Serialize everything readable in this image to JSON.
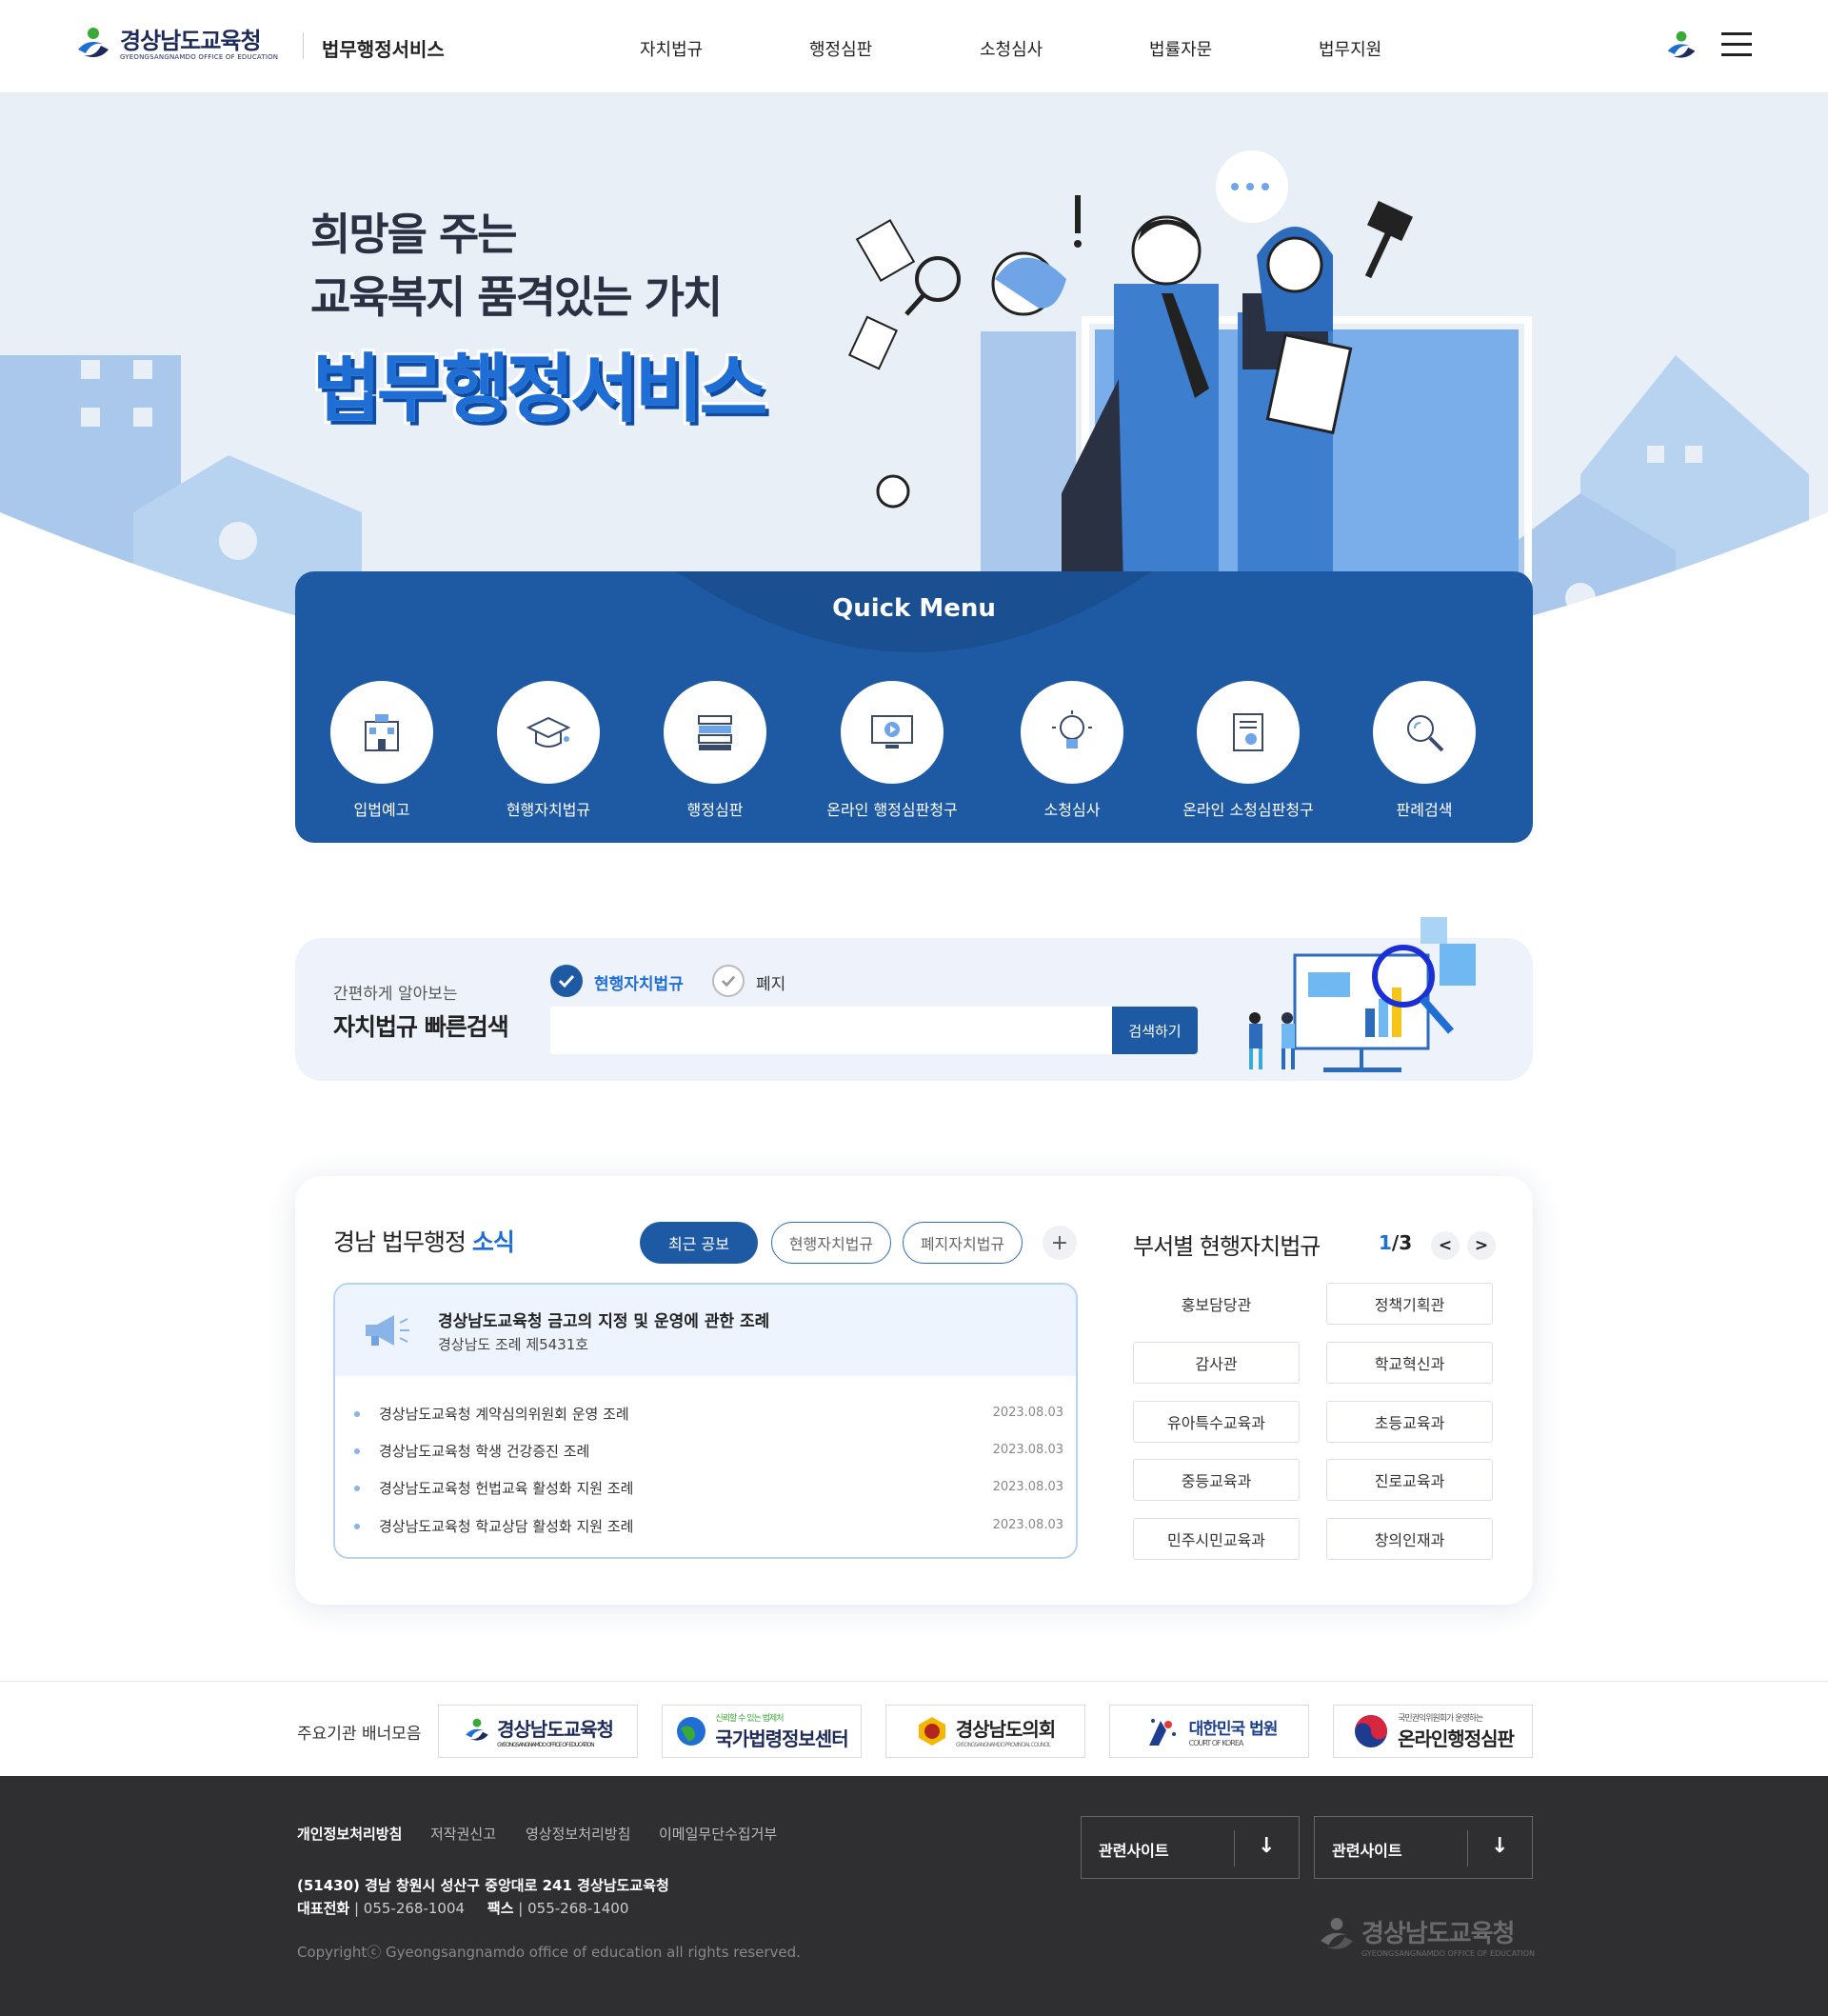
{
  "header": {
    "logo_main": "경상남도교육청",
    "logo_sub": "GYEONGSANGNAMDO OFFICE OF EDUCATION",
    "service_name": "법무행정서비스",
    "nav": [
      "자치법규",
      "행정심판",
      "소청심사",
      "법률자문",
      "법무지원"
    ]
  },
  "hero": {
    "line1": "희망을 주는",
    "line2": "교육복지 품격있는 가치",
    "big": "법무행정서비스"
  },
  "quick_menu": {
    "title": "Quick Menu",
    "items": [
      {
        "label": "입법예고",
        "icon": "building-icon"
      },
      {
        "label": "현행자치법규",
        "icon": "graduation-cap-icon"
      },
      {
        "label": "행정심판",
        "icon": "books-icon"
      },
      {
        "label": "온라인 행정심판청구",
        "icon": "monitor-play-icon"
      },
      {
        "label": "소청심사",
        "icon": "lightbulb-icon"
      },
      {
        "label": "온라인 소청심판청구",
        "icon": "certificate-icon"
      },
      {
        "label": "판례검색",
        "icon": "magnifier-icon"
      }
    ]
  },
  "search": {
    "subtitle": "간편하게 알아보는",
    "title": "자치법규 빠른검색",
    "option_current": "현행자치법규",
    "option_abolished": "폐지",
    "input_value": "",
    "button": "검색하기"
  },
  "news": {
    "title_plain": "경남 법무행정",
    "title_accent": "소식",
    "tabs": [
      "최근 공보",
      "현행자치법규",
      "폐지자치법규"
    ],
    "more": "+",
    "featured": {
      "title": "경상남도교육청 금고의 지정 및 운영에 관한 조례",
      "subtitle": "경상남도 조례 제5431호"
    },
    "items": [
      {
        "title": "경상남도교육청 계약심의위원회 운영 조례",
        "date": "2023.08.03"
      },
      {
        "title": "경상남도교육청 학생 건강증진 조례",
        "date": "2023.08.03"
      },
      {
        "title": "경상남도교육청 헌법교육 활성화 지원 조례",
        "date": "2023.08.03"
      },
      {
        "title": "경상남도교육청 학교상담 활성화 지원 조례",
        "date": "2023.08.03"
      }
    ]
  },
  "departments": {
    "title": "부서별 현행자치법규",
    "page_current": "1",
    "page_total": "/3",
    "prev": "<",
    "next": ">",
    "items": [
      "홍보담당관",
      "정책기획관",
      "감사관",
      "학교혁신과",
      "유아특수교육과",
      "초등교육과",
      "중등교육과",
      "진로교육과",
      "민주시민교육과",
      "창의인재과"
    ]
  },
  "banners": {
    "label": "주요기관 배너모음",
    "items": [
      {
        "name": "경상남도교육청",
        "sub": "GYEONGSANGNAMDO OFFICE OF EDUCATION"
      },
      {
        "name": "국가법령정보센터",
        "sub": "신뢰할 수 있는 법제처"
      },
      {
        "name": "경상남도의회",
        "sub": "GYEONGSANGNAMDO PROVINCIAL COUNCIL"
      },
      {
        "name": "대한민국 법원",
        "sub": "COURT OF KOREA"
      },
      {
        "name": "온라인행정심판",
        "sub": "국민권익위원회가 운영하는"
      }
    ]
  },
  "footer": {
    "links": [
      "개인정보처리방침",
      "저작권신고",
      "영상정보처리방침",
      "이메일무단수집거부"
    ],
    "address": "(51430) 경남 창원시 성산구 중앙대로 241 경상남도교육청",
    "tel_label": "대표전화",
    "tel": "055-268-1004",
    "fax_label": "팩스",
    "fax": "055-268-1400",
    "copyright": "Copyrightⓒ Gyeongsangnamdo office of education all rights reserved.",
    "related1": "관련사이트",
    "related2": "관련사이트",
    "logo_main": "경상남도교육청",
    "logo_sub": "GYEONGSANGNAMDO OFFICE OF EDUCATION"
  },
  "colors": {
    "primary": "#1e5aa3",
    "accent": "#1e6ed6",
    "hero_bg": "#e9eff7",
    "footer_bg": "#2f2f31"
  }
}
